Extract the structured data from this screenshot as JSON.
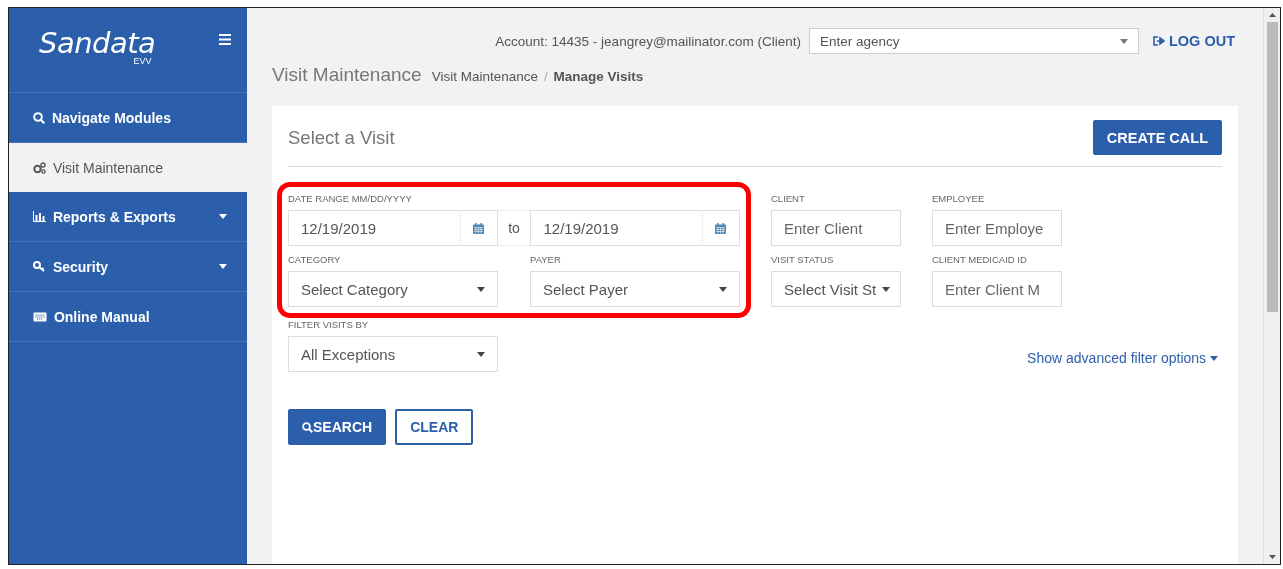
{
  "sidebar": {
    "logo": {
      "name": "Sandata",
      "sub": "EVV"
    },
    "items": [
      {
        "label": "Navigate Modules",
        "selected": false,
        "expandable": false
      },
      {
        "label": "Visit Maintenance",
        "selected": true,
        "expandable": false
      },
      {
        "label": "Reports & Exports",
        "selected": false,
        "expandable": true
      },
      {
        "label": "Security",
        "selected": false,
        "expandable": true
      },
      {
        "label": "Online Manual",
        "selected": false,
        "expandable": false
      }
    ]
  },
  "header": {
    "account": "Account: 14435 - jeangrey@mailinator.com (Client)",
    "agency": {
      "placeholder": "Enter agency"
    },
    "logout": "LOG OUT"
  },
  "page_title": "Visit Maintenance",
  "breadcrumb_separator": "/",
  "breadcrumb": [
    {
      "label": "Visit Maintenance",
      "current": false
    },
    {
      "label": "Manage Visits",
      "current": true
    }
  ],
  "panel": {
    "title": "Select a Visit",
    "create_button": "CREATE CALL",
    "highlighted": true,
    "date_range": {
      "label": "DATE RANGE MM/DD/YYYY",
      "from": "12/19/2019",
      "separator": "to",
      "to": "12/19/2019"
    },
    "category": {
      "label": "CATEGORY",
      "placeholder": "Select Category"
    },
    "payer": {
      "label": "PAYER",
      "placeholder": "Select Payer"
    },
    "fields": [
      {
        "kind": "text",
        "label": "CLIENT",
        "placeholder": "Enter Client"
      },
      {
        "kind": "text",
        "label": "EMPLOYEE",
        "placeholder": "Enter Employe"
      },
      {
        "kind": "select",
        "label": "VISIT STATUS",
        "placeholder": "Select Visit St"
      },
      {
        "kind": "text",
        "label": "CLIENT MEDICAID ID",
        "placeholder": "Enter Client M"
      }
    ],
    "filter_visits_by": {
      "label": "FILTER VISITS BY",
      "value": "All Exceptions"
    },
    "advanced_link": "Show advanced filter options",
    "buttons": [
      {
        "kind": "primary",
        "label": "SEARCH"
      },
      {
        "kind": "secondary",
        "label": "CLEAR"
      }
    ]
  }
}
